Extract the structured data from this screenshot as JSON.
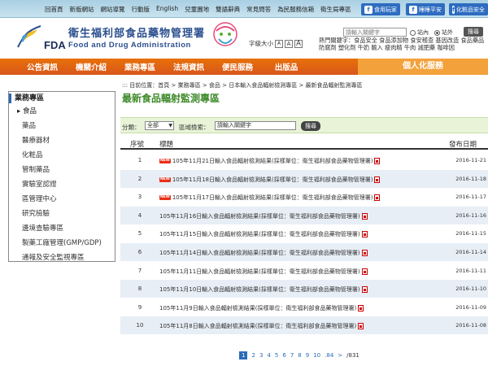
{
  "top_links": [
    "回首頁",
    "新版網站",
    "網站導覽",
    "行動版",
    "English",
    "兒童園地",
    "雙語辭典",
    "常見問答",
    "為民服務信箱",
    "衛生局專區"
  ],
  "top_buttons": [
    "食用玩家",
    "睡睡平安",
    "化粧品安全"
  ],
  "agency": {
    "name_cn": "衛生福利部食品藥物管理署",
    "name_en": "Food and Drug Administration",
    "logo_text": "FDA"
  },
  "search": {
    "placeholder": "請輸入關鍵字",
    "scope_site": "站內",
    "scope_web": "站外",
    "go": "搜尋"
  },
  "font_size": {
    "label": "字級大小",
    "options": [
      "A",
      "A",
      "A"
    ]
  },
  "hot_keywords": {
    "label": "熱門關鍵字：",
    "items": "食品安全 食品添加物 食安稽查 基因改造 食品藥品 防腐劑 塑化劑 牛奶 輸入 瘦肉精 牛肉 減肥藥 咖啡因"
  },
  "nav": [
    "公告資訊",
    "機關介紹",
    "業務專區",
    "法規資訊",
    "便民服務",
    "出版品"
  ],
  "nav_personal": "個人化服務",
  "sidebar": {
    "title": "業務專區",
    "items": [
      "食品",
      "藥品",
      "醫療器材",
      "化粧品",
      "管制藥品",
      "實驗室認證",
      "區管理中心",
      "研究檢驗",
      "邊境查驗專區",
      "製藥工廠管理(GMP/GDP)",
      "通報及安全監視專區"
    ]
  },
  "breadcrumb": "::: 目前位置：首頁 > 業務專區 > 食品 > 日本輸入食品輻射檢測專區 > 最新食品輻射監測專區",
  "page_title": "最新食品輻射監測專區",
  "filter": {
    "category_label": "分類：",
    "category_value": "全部",
    "keyword_label": "區域檢索：",
    "keyword_value": "請輸入關鍵字",
    "button": "搜尋"
  },
  "table": {
    "headers": [
      "序號",
      "標題",
      "發布日期"
    ],
    "rows": [
      {
        "num": "1",
        "title": "105年11月21日輸入食品輻射檢測結果(採樣單位：衛生福利部食品藥物管理署)",
        "date": "2016-11-21",
        "new": true
      },
      {
        "num": "2",
        "title": "105年11月18日輸入食品輻射檢測結果(採樣單位：衛生福利部食品藥物管理署)",
        "date": "2016-11-18",
        "new": true
      },
      {
        "num": "3",
        "title": "105年11月17日輸入食品輻射檢測結果(採樣單位：衛生福利部食品藥物管理署)",
        "date": "2016-11-17",
        "new": true
      },
      {
        "num": "4",
        "title": "105年11月16日輸入食品輻射檢測結果(採樣單位：衛生福利部食品藥物管理署)",
        "date": "2016-11-16",
        "new": false
      },
      {
        "num": "5",
        "title": "105年11月15日輸入食品輻射檢測結果(採樣單位：衛生福利部食品藥物管理署)",
        "date": "2016-11-15",
        "new": false
      },
      {
        "num": "6",
        "title": "105年11月14日輸入食品輻射檢測結果(採樣單位：衛生福利部食品藥物管理署)",
        "date": "2016-11-14",
        "new": false
      },
      {
        "num": "7",
        "title": "105年11月11日輸入食品輻射檢測結果(採樣單位：衛生福利部食品藥物管理署)",
        "date": "2016-11-11",
        "new": false
      },
      {
        "num": "8",
        "title": "105年11月10日輸入食品輻射檢測結果(採樣單位：衛生福利部食品藥物管理署)",
        "date": "2016-11-10",
        "new": false
      },
      {
        "num": "9",
        "title": "105年11月9日輸入食品輻射檢測結果(採樣單位：衛生福利部食品藥物管理署)",
        "date": "2016-11-09",
        "new": false
      },
      {
        "num": "10",
        "title": "105年11月8日輸入食品輻射檢測結果(採樣單位：衛生福利部食品藥物管理署)",
        "date": "2016-11-08",
        "new": false
      }
    ]
  },
  "pager": {
    "pages": [
      "1",
      "2",
      "3",
      "4",
      "5",
      "6",
      "7",
      "8",
      "9",
      "10",
      ".84",
      ">",
      "/831"
    ],
    "current": "1"
  },
  "colors": {
    "nav_orange": "#e8710a",
    "title_green": "#3e8a2a",
    "link_blue": "#2a6bb8",
    "row_alt": "#e7eef6"
  }
}
